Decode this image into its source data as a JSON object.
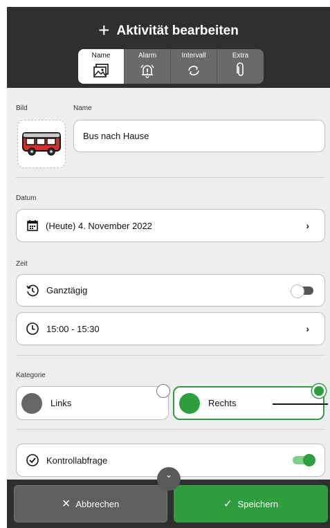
{
  "header": {
    "title": "Aktivität bearbeiten",
    "tabs": [
      {
        "label": "Name",
        "icon": "image-icon",
        "active": true
      },
      {
        "label": "Alarm",
        "icon": "alarm-bell-icon",
        "active": false
      },
      {
        "label": "Intervall",
        "icon": "repeat-icon",
        "active": false
      },
      {
        "label": "Extra",
        "icon": "paperclip-icon",
        "active": false
      }
    ]
  },
  "form": {
    "bild_label": "Bild",
    "name_label": "Name",
    "name_value": "Bus nach Hause",
    "datum_label": "Datum",
    "datum_value": "(Heute) 4. November 2022",
    "zeit_label": "Zeit",
    "ganztaegig_label": "Ganztägig",
    "ganztaegig_on": false,
    "time_value": "15:00 - 15:30",
    "kategorie_label": "Kategorie",
    "kategorien": [
      {
        "label": "Links",
        "color": "#666666",
        "selected": false
      },
      {
        "label": "Rechts",
        "color": "#2e9e3e",
        "selected": true
      }
    ],
    "kontroll_label": "Kontrollabfrage",
    "kontroll_on": true
  },
  "footer": {
    "cancel_label": "Abbrechen",
    "save_label": "Speichern"
  },
  "colors": {
    "header_bg": "#2f2f2f",
    "accent_green": "#2e9e3e",
    "cancel_bg": "#5f5f5f"
  }
}
